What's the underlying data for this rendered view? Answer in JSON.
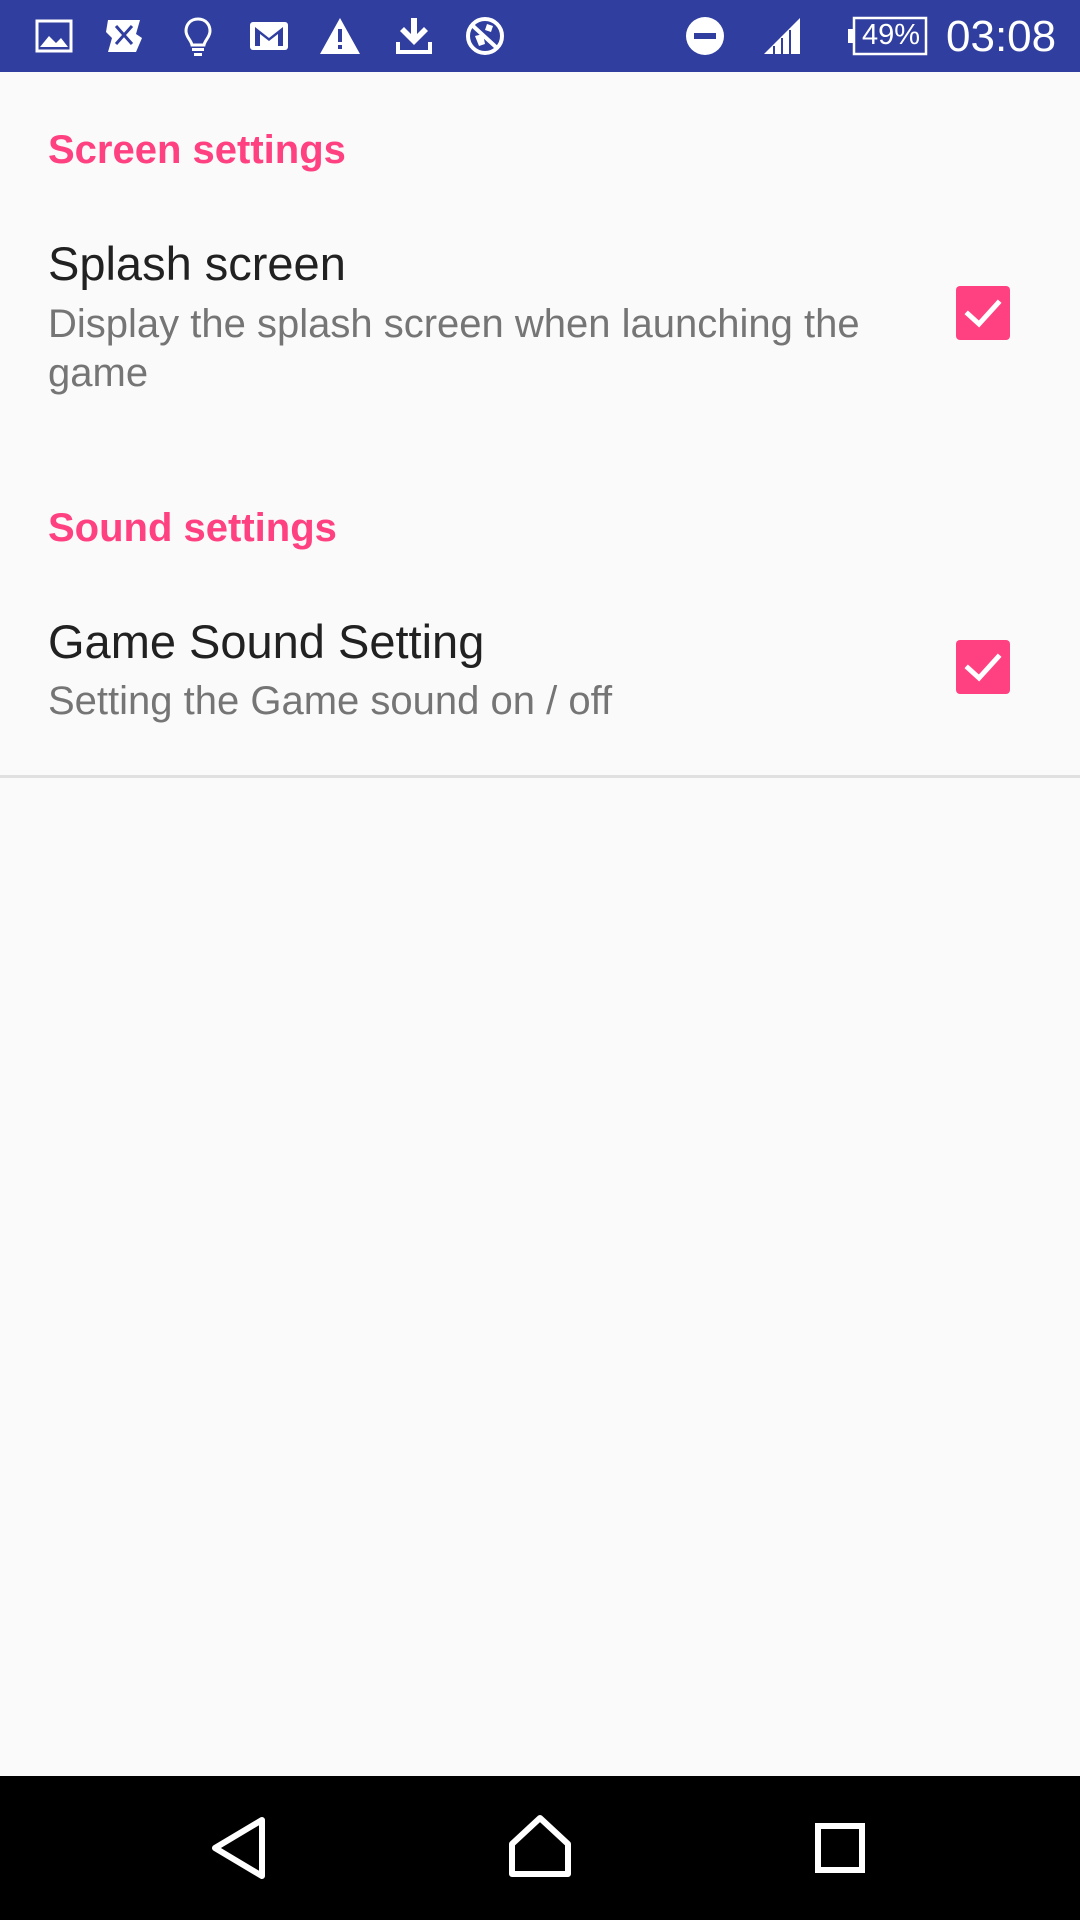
{
  "status_bar": {
    "left_icons": [
      "image-icon",
      "app-icon",
      "lightbulb-icon",
      "gmail-icon",
      "warning-icon",
      "download-icon",
      "vpn-icon"
    ],
    "right_icons": [
      "do-not-disturb-icon",
      "signal-icon"
    ],
    "battery": "49%",
    "time": "03:08",
    "background": "#303F9F"
  },
  "sections": [
    {
      "header": "Screen settings",
      "items": [
        {
          "title": "Splash screen",
          "summary": "Display the splash screen when launching the game",
          "checked": true
        }
      ]
    },
    {
      "header": "Sound settings",
      "items": [
        {
          "title": "Game Sound Setting",
          "summary": "Setting the Game sound on / off",
          "checked": true
        }
      ]
    }
  ],
  "nav_bar": {
    "buttons": [
      "back-icon",
      "home-icon",
      "recents-icon"
    ]
  },
  "colors": {
    "accent": "#FF4081",
    "title": "#212121",
    "summary": "#757575",
    "background": "#FAFAFA"
  }
}
